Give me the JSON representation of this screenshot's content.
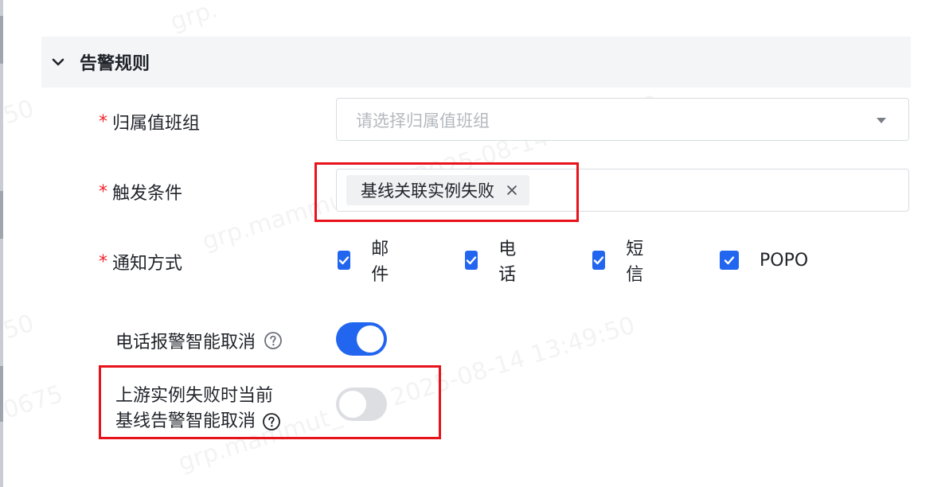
{
  "section": {
    "title": "告警规则"
  },
  "form": {
    "oncall_group": {
      "label": "归属值班组",
      "placeholder": "请选择归属值班组"
    },
    "trigger_condition": {
      "label": "触发条件",
      "tags": [
        "基线关联实例失败"
      ]
    },
    "notify_method": {
      "label": "通知方式",
      "options": [
        {
          "label": "邮件",
          "checked": true
        },
        {
          "label": "电话",
          "checked": true
        },
        {
          "label": "短信",
          "checked": true
        },
        {
          "label": "POPO",
          "checked": true
        }
      ]
    },
    "phone_smart_cancel": {
      "label": "电话报警智能取消",
      "enabled": true
    },
    "upstream_smart_cancel": {
      "label_line1": "上游实例失败时当前",
      "label_line2": "基线告警智能取消",
      "enabled": false
    }
  },
  "watermark": {
    "text_full": "grp.mammut_test 2025-08-14 13:49:50",
    "text_date": "2025-08-14 13:49:50",
    "text_time": "13:49:50"
  },
  "colors": {
    "accent": "#2266f0",
    "required": "#f5222d",
    "highlight_box": "#e8121b",
    "header_bg": "#f4f5f7"
  }
}
